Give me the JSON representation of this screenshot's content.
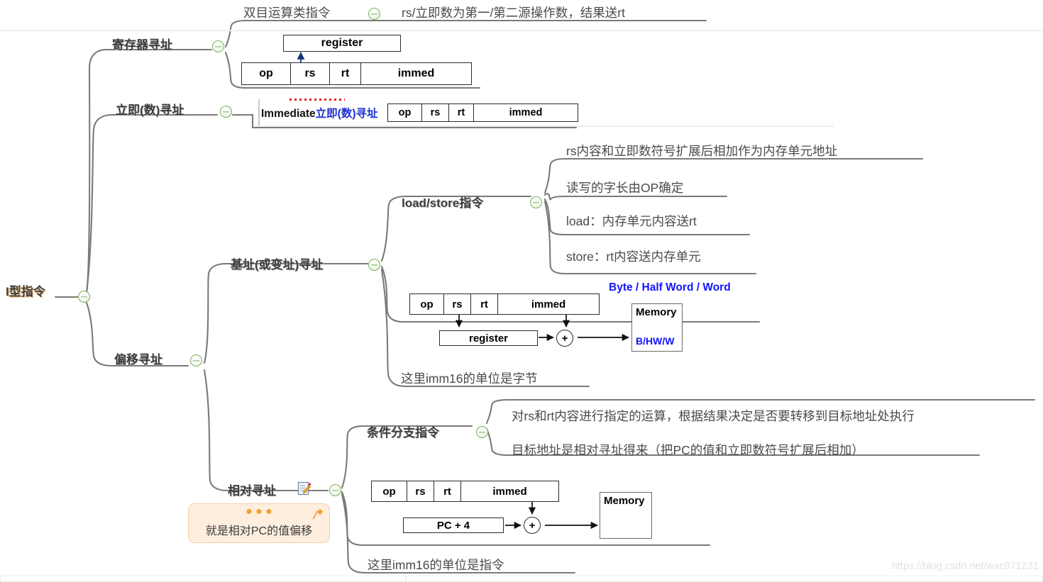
{
  "map": {
    "root": {
      "label": "I型指令"
    },
    "branches": [
      {
        "label": "寄存器寻址"
      },
      {
        "label": "立即(数)寻址"
      },
      {
        "label": "偏移寻址"
      },
      {
        "label": "基址(或变址)寻址"
      },
      {
        "label": "load/store指令"
      },
      {
        "label": "相对寻址"
      },
      {
        "label": "条件分支指令"
      }
    ],
    "leaves": {
      "reg_note": "rs/立即数为第一/第二源操作数，结果送rt",
      "reg_title": "双目运算类指令",
      "ls_1": "rs内容和立即数符号扩展后相加作为内存单元地址",
      "ls_2": "读写的字长由OP确定",
      "ls_3": "load：内存单元内容送rt",
      "ls_4": "store：rt内容送内存单元",
      "base_note": "这里imm16的单位是字节",
      "branch_1": "对rs和rt内容进行指定的运算，根据结果决定是否要转移到目标地址处执行",
      "branch_2": "目标地址是相对寻址得来（把PC的值和立即数符号扩展后相加）",
      "rel_note": "这里imm16的单位是指令"
    },
    "note_callout": {
      "text": "就是相对PC的值偏移"
    }
  },
  "figures": {
    "fmt_fields": {
      "op": "op",
      "rs": "rs",
      "rt": "rt",
      "immed": "immed"
    },
    "register_label": "register",
    "memory_label": "Memory",
    "memory_sub": "B/HW/W",
    "byte_caption": "Byte / Half Word / Word",
    "pc_label": "PC + 4",
    "adder": "+",
    "immediate_caption_en": "Immediate",
    "immediate_caption_cn": "立即(数)寻址"
  },
  "watermark": {
    "text": "https://blog.csdn.net/wxc971231"
  },
  "colors": {
    "node_text": "#3d3d3d",
    "leaf_text": "#4a4a4a",
    "line": "#7a7a7a",
    "toggle_green": "#79b25c",
    "blue": "#1414ff",
    "note_bg": "#fdeede",
    "note_border": "#f2d3ad",
    "root_shadow": "#e9b77a",
    "red_dotted": "#e02020"
  }
}
